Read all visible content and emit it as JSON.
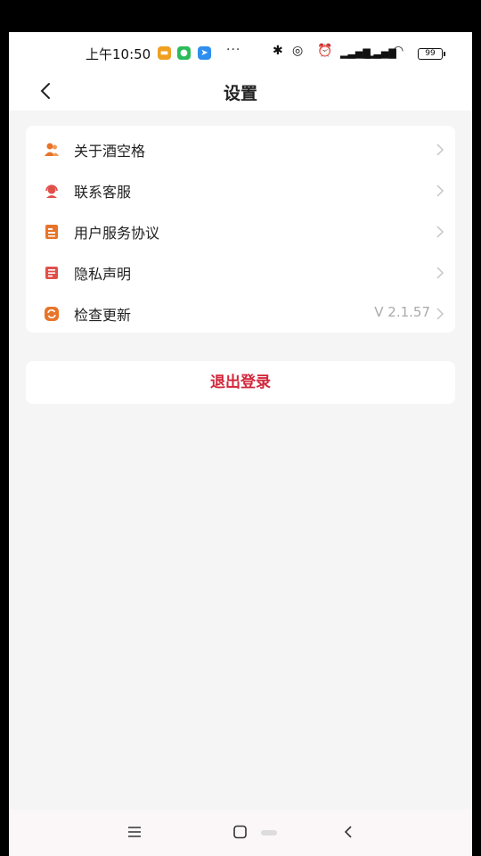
{
  "status_bar": {
    "time": "上午10:50",
    "battery": "99",
    "overflow": "···"
  },
  "nav": {
    "title": "设置"
  },
  "menu": [
    {
      "label": "关于酒空格",
      "icon": "people-icon",
      "value": ""
    },
    {
      "label": "联系客服",
      "icon": "headset-icon",
      "value": ""
    },
    {
      "label": "用户服务协议",
      "icon": "document-icon",
      "value": ""
    },
    {
      "label": "隐私声明",
      "icon": "list-doc-icon",
      "value": ""
    },
    {
      "label": "检查更新",
      "icon": "refresh-icon",
      "value": "V 2.1.57"
    }
  ],
  "logout": {
    "label": "退出登录"
  },
  "colors": {
    "accent": "#e8742a",
    "danger": "#d2283c",
    "headset": "#e0504a"
  }
}
